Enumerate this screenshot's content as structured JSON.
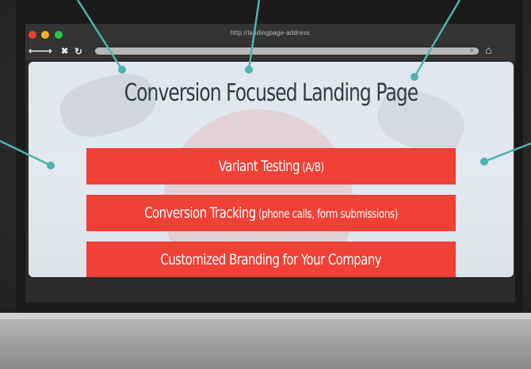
{
  "browser": {
    "url": "http://landingpage-address",
    "traffic_lights": {
      "close": "#ec3f35",
      "minimize": "#f6b12c",
      "maximize": "#2bc24c"
    },
    "nav": {
      "back_forward": "⟵⟶",
      "stop": "✖",
      "reload": "↻",
      "home": "⌂",
      "search": "⌕"
    }
  },
  "page": {
    "title": "Conversion Focused Landing Page",
    "features": [
      {
        "main": "Variant Testing",
        "sub": "(A/B)"
      },
      {
        "main": "Conversion Tracking",
        "sub": "(phone calls, form submissions)"
      },
      {
        "main": "Customized Branding for Your Company",
        "sub": ""
      }
    ]
  },
  "colors": {
    "accent": "#ef4136",
    "title_text": "#2f3b49",
    "callout": "#4fb3ae"
  }
}
